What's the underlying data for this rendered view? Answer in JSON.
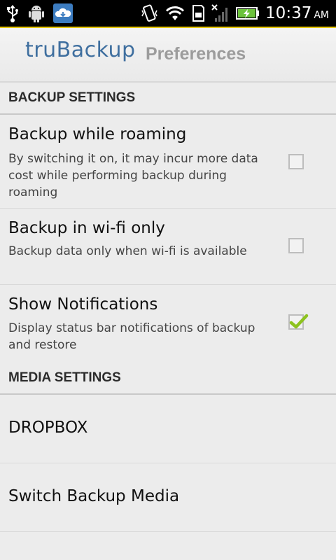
{
  "status_bar": {
    "time": "10:37",
    "ampm": "AM",
    "icons": [
      "usb-icon",
      "android-debug-icon",
      "cloud-app-icon",
      "vibrate-icon",
      "wifi-icon",
      "sd-card-icon",
      "signal-icon",
      "battery-charging-icon"
    ]
  },
  "header": {
    "app_name": "truBackup",
    "title": "Preferences"
  },
  "sections": [
    {
      "header": "BACKUP SETTINGS",
      "items": [
        {
          "title": "Backup while roaming",
          "summary": "By switching it on, it may incur more data cost while performing backup during roaming",
          "checked": false
        },
        {
          "title": "Backup in wi-fi only",
          "summary": "Backup data only when wi-fi is available",
          "checked": false
        },
        {
          "title": "Show Notifications",
          "summary": "Display status bar notifications of backup and restore",
          "checked": true
        }
      ]
    },
    {
      "header": "MEDIA SETTINGS",
      "items": [
        {
          "title": "DROPBOX"
        },
        {
          "title": "Switch Backup Media"
        }
      ]
    }
  ],
  "colors": {
    "accent": "#e8c800",
    "check": "#8dc21f",
    "logo": "#3f6f9f"
  }
}
